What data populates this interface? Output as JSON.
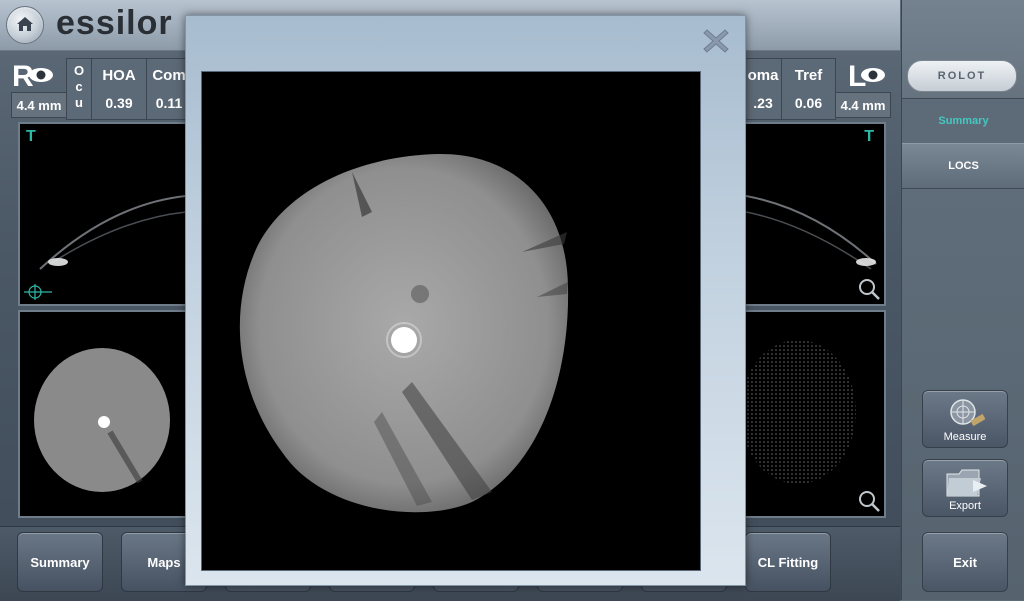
{
  "app": {
    "logo_text": "essilor",
    "home_icon": "home-icon"
  },
  "right_eye": {
    "letter": "R",
    "pupil": "4.4 mm",
    "ocu_header": "Ocu",
    "columns": [
      {
        "header": "HOA",
        "value": "0.39"
      },
      {
        "header": "Com",
        "value": "0.11"
      }
    ],
    "t_label": "T"
  },
  "left_eye": {
    "letter": "L",
    "pupil": "4.4 mm",
    "columns": [
      {
        "header": "oma",
        "value": ".23"
      },
      {
        "header": "Tref",
        "value": "0.06"
      }
    ],
    "t_label": "T"
  },
  "right_panel": {
    "brand_badge": "ROLOT",
    "tabs": [
      {
        "label": "Summary",
        "active": true
      },
      {
        "label": "LOCS",
        "active": false
      }
    ],
    "tools": [
      {
        "label": "Measure",
        "icon": "measure-icon"
      },
      {
        "label": "Export",
        "icon": "export-folder-icon"
      }
    ],
    "exit_label": "Exit"
  },
  "bottom_nav": [
    {
      "label": "Summary"
    },
    {
      "label": "Maps"
    },
    {
      "label": "CL Fitting"
    }
  ],
  "modal": {
    "close_icon": "close-icon"
  },
  "colors": {
    "accent": "#2fb8a8",
    "tab_active": "#45c8c0"
  }
}
